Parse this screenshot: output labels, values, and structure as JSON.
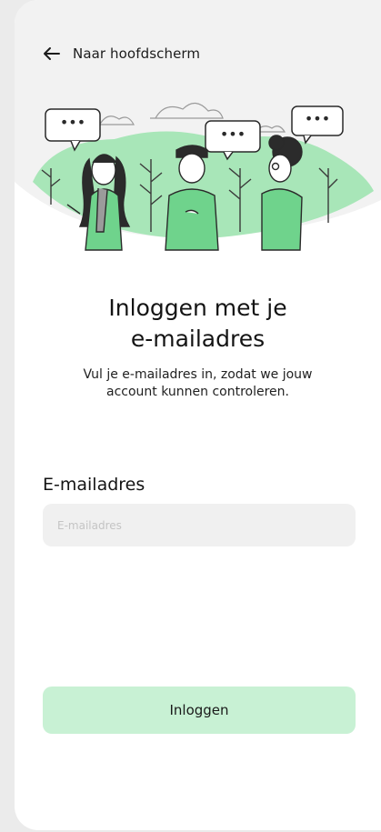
{
  "nav": {
    "back_label": "Naar hoofdscherm",
    "back_icon": "arrow-left-icon"
  },
  "hero": {
    "illustration": "three-people-talking-illustration",
    "speech_bubble_text": "•••"
  },
  "content": {
    "title_line1": "Inloggen met je",
    "title_line2": "e-mailadres",
    "subtitle": "Vul je e-mailadres in, zodat we jouw account kunnen controleren."
  },
  "form": {
    "email_label": "E-mailadres",
    "email_placeholder": "E-mailadres",
    "email_value": "",
    "submit_label": "Inloggen"
  },
  "colors": {
    "accent_green": "#c8f1d4",
    "illustration_green": "#6fd38c",
    "illustration_light_green": "#a8e6b8",
    "card_background": "#ffffff",
    "page_background": "#ebebeb",
    "input_background": "#f0f0f0"
  }
}
